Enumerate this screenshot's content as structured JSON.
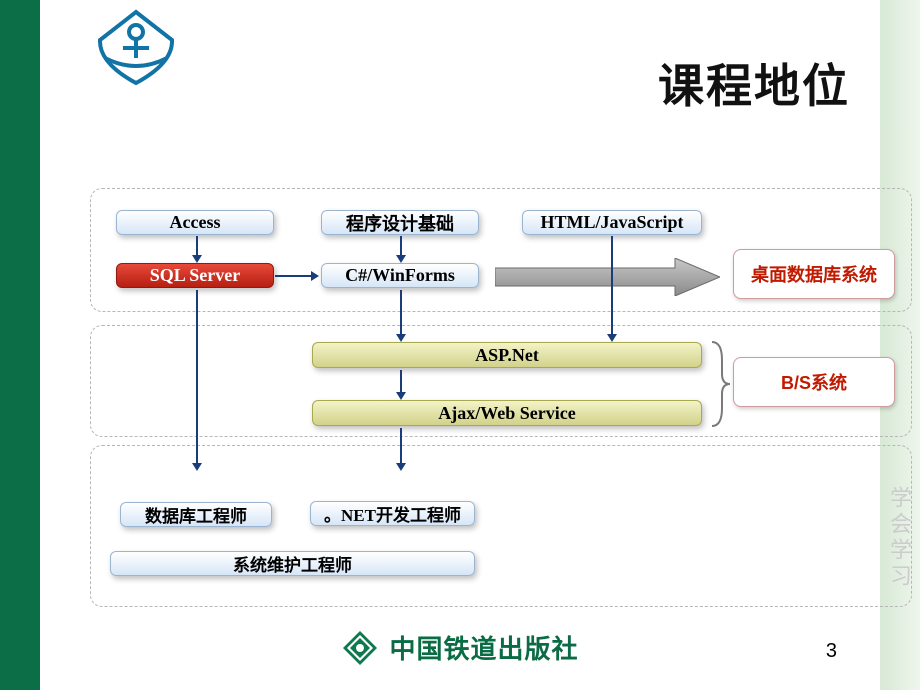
{
  "title": "课程地位",
  "section1": {
    "access": "Access",
    "sqlserver": "SQL Server",
    "prog_basics": "程序设计基础",
    "csharp": "C#/WinForms",
    "htmljs": "HTML/JavaScript",
    "desktop_db": "桌面数据库系统"
  },
  "section2": {
    "aspnet": "ASP.Net",
    "ajax": "Ajax/Web Service",
    "bs": "B/S系统"
  },
  "section3": {
    "db_engineer": "数据库工程师",
    "net_dev": "。NET开发工程师",
    "sysops": "系统维护工程师"
  },
  "footer": "中国铁道出版社",
  "page_number": "3",
  "watermark": "学会学习"
}
